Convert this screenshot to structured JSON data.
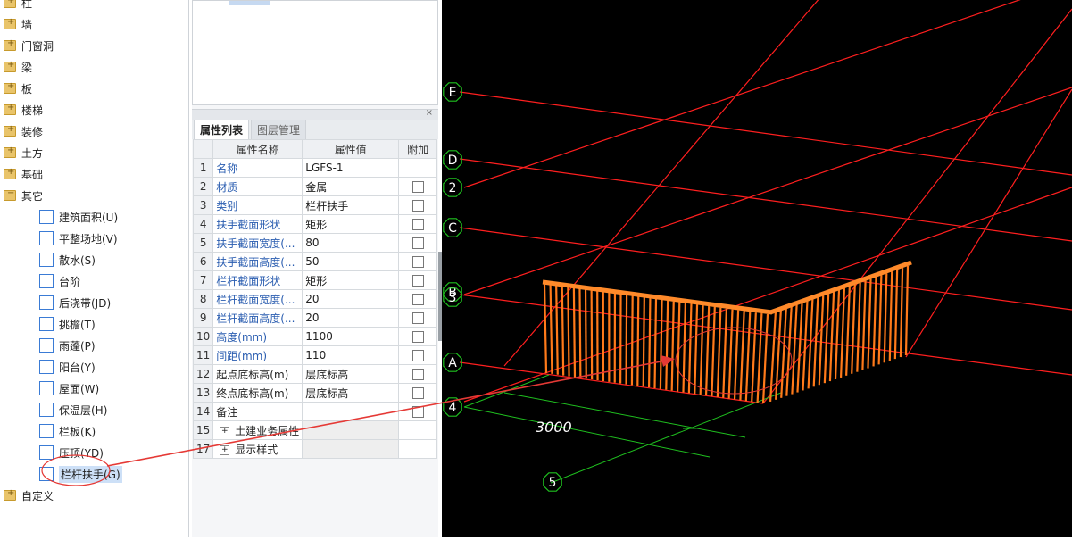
{
  "tree": {
    "top_items": [
      {
        "label": "柱",
        "state": "plus"
      },
      {
        "label": "墙",
        "state": "plus"
      },
      {
        "label": "门窗洞",
        "state": "plus"
      },
      {
        "label": "梁",
        "state": "plus"
      },
      {
        "label": "板",
        "state": "plus"
      },
      {
        "label": "楼梯",
        "state": "plus"
      },
      {
        "label": "装修",
        "state": "plus"
      },
      {
        "label": "土方",
        "state": "plus"
      },
      {
        "label": "基础",
        "state": "plus"
      },
      {
        "label": "其它",
        "state": "minus"
      }
    ],
    "sub_items": [
      "建筑面积(U)",
      "平整场地(V)",
      "散水(S)",
      "台阶",
      "后浇带(JD)",
      "挑檐(T)",
      "雨蓬(P)",
      "阳台(Y)",
      "屋面(W)",
      "保温层(H)",
      "栏板(K)",
      "压顶(YD)",
      "栏杆扶手(G)"
    ],
    "last_item": "自定义",
    "selected": "栏杆扶手(G)"
  },
  "panel": {
    "close": "×",
    "tabs": [
      "属性列表",
      "图层管理"
    ],
    "headers": [
      "属性名称",
      "属性值",
      "附加"
    ],
    "rows": [
      {
        "n": "1",
        "name": "名称",
        "value": "LGFS-1",
        "blue": true,
        "cb": false
      },
      {
        "n": "2",
        "name": "材质",
        "value": "金属",
        "blue": true,
        "cb": true
      },
      {
        "n": "3",
        "name": "类别",
        "value": "栏杆扶手",
        "blue": true,
        "cb": true
      },
      {
        "n": "4",
        "name": "扶手截面形状",
        "value": "矩形",
        "blue": true,
        "cb": true
      },
      {
        "n": "5",
        "name": "扶手截面宽度(...",
        "value": "80",
        "blue": true,
        "cb": true
      },
      {
        "n": "6",
        "name": "扶手截面高度(...",
        "value": "50",
        "blue": true,
        "cb": true
      },
      {
        "n": "7",
        "name": "栏杆截面形状",
        "value": "矩形",
        "blue": true,
        "cb": true
      },
      {
        "n": "8",
        "name": "栏杆截面宽度(...",
        "value": "20",
        "blue": true,
        "cb": true
      },
      {
        "n": "9",
        "name": "栏杆截面高度(...",
        "value": "20",
        "blue": true,
        "cb": true
      },
      {
        "n": "10",
        "name": "高度(mm)",
        "value": "1100",
        "blue": true,
        "cb": true
      },
      {
        "n": "11",
        "name": "间距(mm)",
        "value": "110",
        "blue": true,
        "cb": true
      },
      {
        "n": "12",
        "name": "起点底标高(m)",
        "value": "层底标高",
        "blue": false,
        "cb": true
      },
      {
        "n": "13",
        "name": "终点底标高(m)",
        "value": "层底标高",
        "blue": false,
        "cb": true
      },
      {
        "n": "14",
        "name": "备注",
        "value": "",
        "blue": false,
        "cb": true
      }
    ],
    "groups": [
      {
        "n": "15",
        "name": "土建业务属性"
      },
      {
        "n": "17",
        "name": "显示样式"
      }
    ]
  },
  "viewport": {
    "axis_labels": [
      "E",
      "D",
      "2",
      "C",
      "B",
      "3",
      "A",
      "4",
      "5"
    ],
    "dimension": "3000"
  }
}
